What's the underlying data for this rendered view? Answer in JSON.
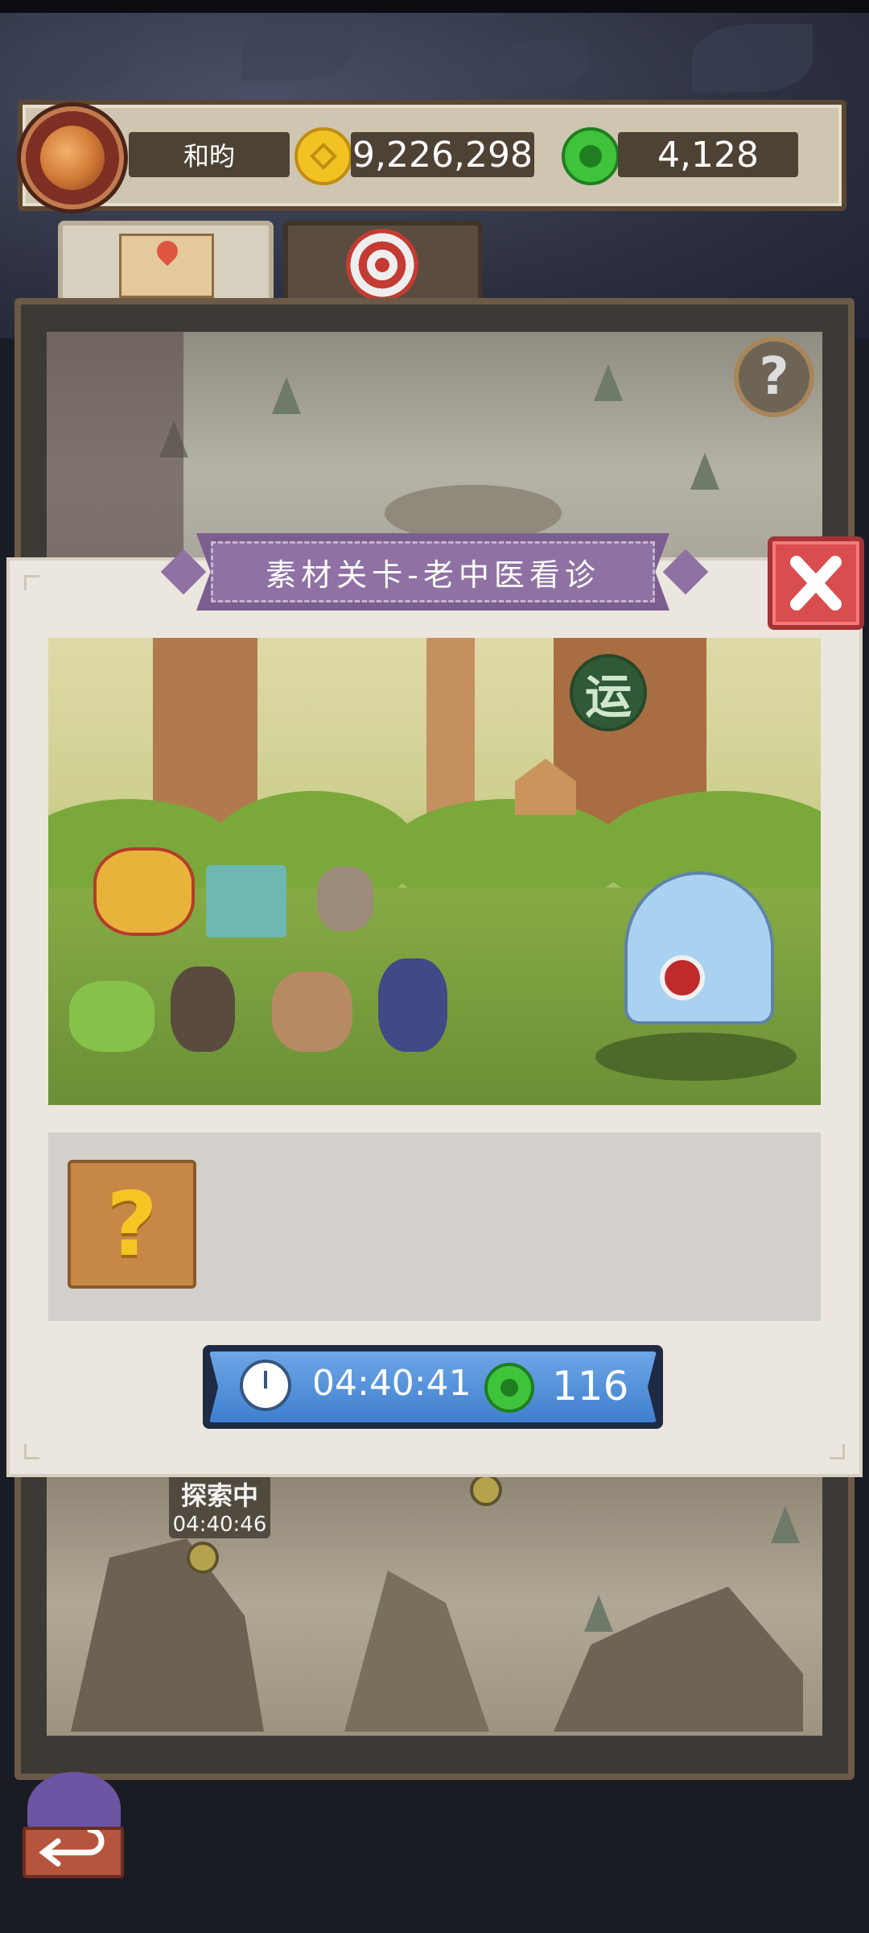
{
  "player": {
    "name": "和昀",
    "coins": "9,226,298",
    "jade": "4,128"
  },
  "tabs": [
    {
      "name": "map",
      "icon": "map-icon",
      "active": true
    },
    {
      "name": "target",
      "icon": "target-icon",
      "active": false
    }
  ],
  "modal": {
    "title": "素材关卡-老中医看诊",
    "scene_badge": "运",
    "reward_placeholder": "?",
    "timer": "04:40:41",
    "cost": "116"
  },
  "map": {
    "help_label": "?",
    "exploring_label": "探索中",
    "exploring_timer": "04:40:46"
  },
  "colors": {
    "close_button": "#d94d4f",
    "banner": "#8f72a3",
    "action_button": "#3f7fcf",
    "coin": "#f2c224",
    "jade": "#3fc33a"
  }
}
